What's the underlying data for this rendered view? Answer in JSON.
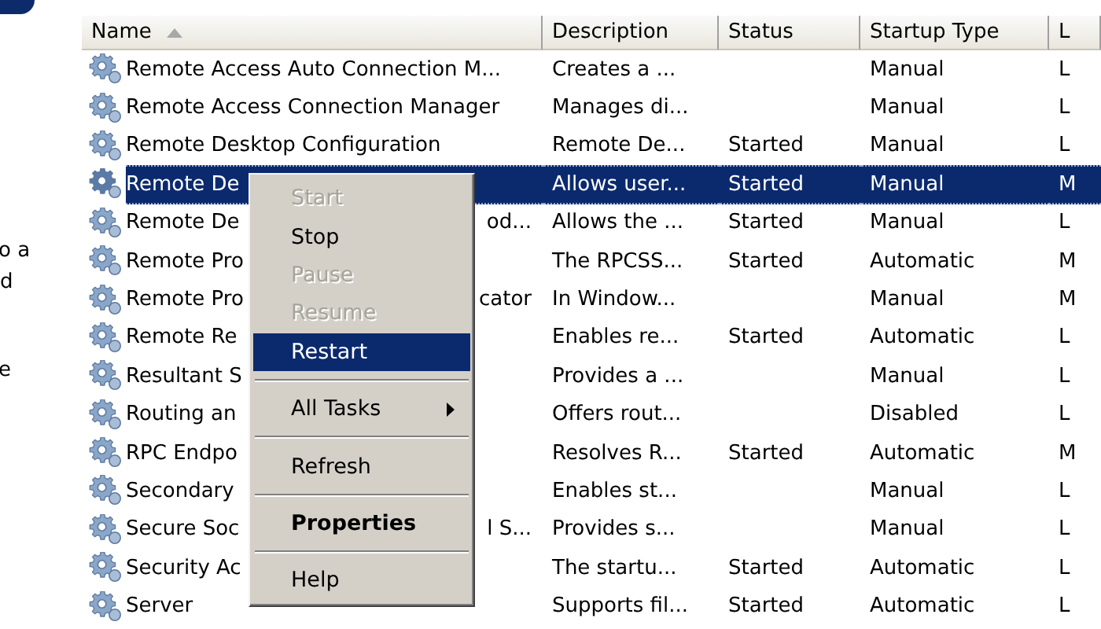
{
  "left_pane": {
    "texts": [
      "o a",
      "d",
      "e"
    ]
  },
  "table": {
    "columns": [
      {
        "label": "Name",
        "sorted": true
      },
      {
        "label": "Description",
        "sorted": false
      },
      {
        "label": "Status",
        "sorted": false
      },
      {
        "label": "Startup Type",
        "sorted": false
      },
      {
        "label": "L",
        "sorted": false
      }
    ],
    "rows": [
      {
        "name": "Remote Access Auto Connection M...",
        "description": "Creates a ...",
        "status": "",
        "startup_type": "Manual",
        "column_5": "L",
        "selected": false
      },
      {
        "name": "Remote Access Connection Manager",
        "description": "Manages di...",
        "status": "",
        "startup_type": "Manual",
        "column_5": "L",
        "selected": false
      },
      {
        "name": "Remote Desktop Configuration",
        "description": "Remote De...",
        "status": "Started",
        "startup_type": "Manual",
        "column_5": "L",
        "selected": false
      },
      {
        "name": "Remote De",
        "description": "Allows user...",
        "status": "Started",
        "startup_type": "Manual",
        "column_5": "M",
        "selected": true
      },
      {
        "name": "Remote De",
        "name_end": "od...",
        "description": "Allows the ...",
        "status": "Started",
        "startup_type": "Manual",
        "column_5": "L",
        "selected": false
      },
      {
        "name": "Remote Pro",
        "description": "The RPCSS...",
        "status": "Started",
        "startup_type": "Automatic",
        "column_5": "M",
        "selected": false
      },
      {
        "name": "Remote Pro",
        "name_end": "cator",
        "description": "In Window...",
        "status": "",
        "startup_type": "Manual",
        "column_5": "M",
        "selected": false
      },
      {
        "name": "Remote Re",
        "description": "Enables re...",
        "status": "Started",
        "startup_type": "Automatic",
        "column_5": "L",
        "selected": false
      },
      {
        "name": "Resultant S",
        "description": "Provides a ...",
        "status": "",
        "startup_type": "Manual",
        "column_5": "L",
        "selected": false
      },
      {
        "name": "Routing an",
        "description": "Offers rout...",
        "status": "",
        "startup_type": "Disabled",
        "column_5": "L",
        "selected": false
      },
      {
        "name": "RPC Endpo",
        "description": "Resolves R...",
        "status": "Started",
        "startup_type": "Automatic",
        "column_5": "M",
        "selected": false
      },
      {
        "name": "Secondary",
        "description": "Enables st...",
        "status": "",
        "startup_type": "Manual",
        "column_5": "L",
        "selected": false
      },
      {
        "name": "Secure Soc",
        "name_end": "l S...",
        "description": "Provides s...",
        "status": "",
        "startup_type": "Manual",
        "column_5": "L",
        "selected": false
      },
      {
        "name": "Security Ac",
        "description": "The startu...",
        "status": "Started",
        "startup_type": "Automatic",
        "column_5": "L",
        "selected": false
      },
      {
        "name": "Server",
        "description": "Supports fil...",
        "status": "Started",
        "startup_type": "Automatic",
        "column_5": "L",
        "selected": false
      }
    ]
  },
  "context_menu": {
    "items": [
      {
        "kind": "item",
        "label": "Start",
        "disabled": true,
        "selected": false,
        "bold": false,
        "submenu": false
      },
      {
        "kind": "item",
        "label": "Stop",
        "disabled": false,
        "selected": false,
        "bold": false,
        "submenu": false
      },
      {
        "kind": "item",
        "label": "Pause",
        "disabled": true,
        "selected": false,
        "bold": false,
        "submenu": false
      },
      {
        "kind": "item",
        "label": "Resume",
        "disabled": true,
        "selected": false,
        "bold": false,
        "submenu": false
      },
      {
        "kind": "item",
        "label": "Restart",
        "disabled": false,
        "selected": true,
        "bold": false,
        "submenu": false
      },
      {
        "kind": "separator"
      },
      {
        "kind": "item",
        "label": "All Tasks",
        "disabled": false,
        "selected": false,
        "bold": false,
        "submenu": true
      },
      {
        "kind": "separator"
      },
      {
        "kind": "item",
        "label": "Refresh",
        "disabled": false,
        "selected": false,
        "bold": false,
        "submenu": false
      },
      {
        "kind": "separator"
      },
      {
        "kind": "item",
        "label": "Properties",
        "disabled": false,
        "selected": false,
        "bold": true,
        "submenu": false
      },
      {
        "kind": "separator"
      },
      {
        "kind": "item",
        "label": "Help",
        "disabled": false,
        "selected": false,
        "bold": false,
        "submenu": false
      }
    ]
  }
}
